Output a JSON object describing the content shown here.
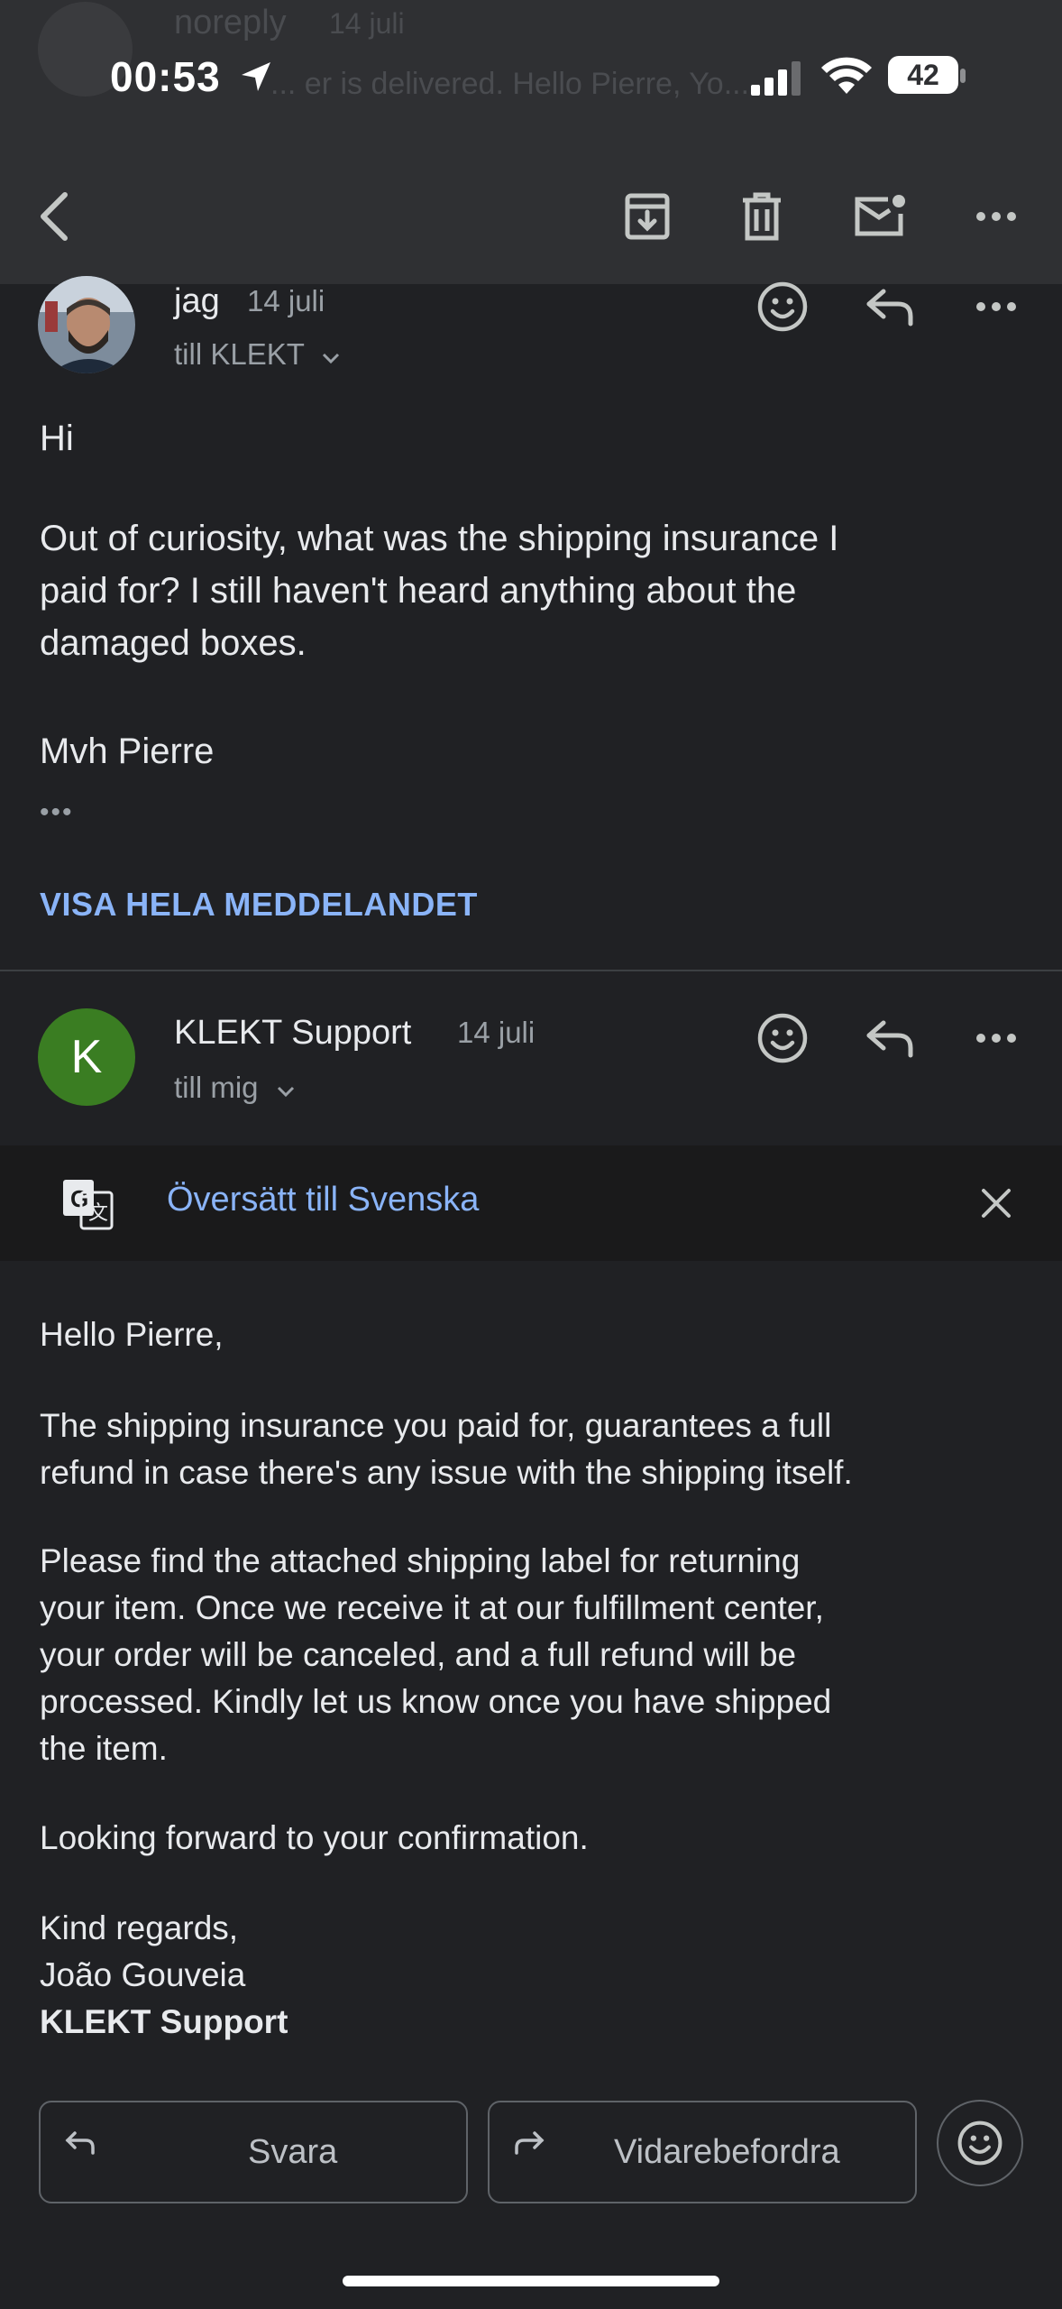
{
  "status_bar": {
    "time": "00:53",
    "battery": "42"
  },
  "ghost_header": {
    "sender": "noreply",
    "date": "14 juli",
    "snippet": "... er is delivered. Hello Pierre, Yo..."
  },
  "toolbar": {
    "back_icon": "back-chevron-icon",
    "archive_icon": "archive-icon",
    "delete_icon": "trash-icon",
    "mark_unread_icon": "mark-unread-icon",
    "more_icon": "more-horizontal-icon"
  },
  "message1": {
    "sender": "jag",
    "date": "14 juli",
    "to": "till KLEKT",
    "body": {
      "greeting": "Hi",
      "line1": "Out of curiosity, what was the shipping insurance I",
      "line2": "paid for? I still haven't heard anything about the",
      "line3": "damaged boxes.",
      "signoff": "Mvh Pierre"
    },
    "ellipsis": "•••",
    "show_full": "VISA HELA MEDDELANDET"
  },
  "message2": {
    "sender": "KLEKT Support",
    "avatar_letter": "K",
    "date": "14 juli",
    "to": "till mig",
    "translate_label": "Översätt till Svenska",
    "body": {
      "greeting": "Hello Pierre,",
      "p1_l1": "The shipping insurance you paid for, guarantees a full",
      "p1_l2": "refund in case there's any issue with the shipping itself.",
      "p2_l1": "Please find the attached shipping label for returning",
      "p2_l2": "your item. Once we receive it at our fulfillment center,",
      "p2_l3": "your order will be canceled, and a full refund will be",
      "p2_l4": "processed. Kindly let us know once you have shipped",
      "p2_l5": "the item.",
      "p3": "Looking forward to your confirmation.",
      "sig1": "Kind regards,",
      "sig2": "João Gouveia",
      "sig3": "KLEKT Support"
    }
  },
  "actions": {
    "reply": "Svara",
    "forward": "Vidarebefordra"
  },
  "colors": {
    "link": "#8ab4f8",
    "avatar_green": "#3a7d22",
    "background": "#202124",
    "toolbar": "#2f3033"
  }
}
